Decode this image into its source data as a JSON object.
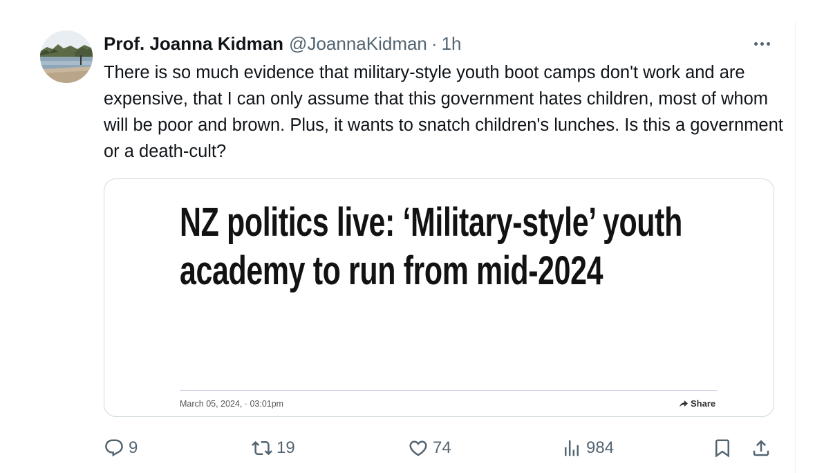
{
  "author": {
    "display_name": "Prof. Joanna Kidman",
    "handle": "@JoannaKidman",
    "separator": "·",
    "time": "1h"
  },
  "tweet": {
    "text": "There is so much evidence that military-style youth boot camps don't work and are expensive, that I can only assume that this government hates children, most of whom will be poor and brown. Plus, it wants to snatch children's lunches. Is this a government or a death-cult?"
  },
  "card": {
    "headline": "NZ politics live: ‘Military-style’ youth academy to run from mid-2024",
    "date": "March 05, 2024, · 03:01pm",
    "share_label": "Share"
  },
  "actions": {
    "replies": "9",
    "retweets": "19",
    "likes": "74",
    "views": "984"
  },
  "icons": {
    "more": "more-horizontal-icon",
    "reply": "reply-icon",
    "retweet": "retweet-icon",
    "like": "heart-icon",
    "views": "analytics-icon",
    "bookmark": "bookmark-icon",
    "share": "share-icon",
    "card_share": "share-arrow-icon"
  },
  "colors": {
    "text_primary": "#0f1419",
    "text_secondary": "#536471",
    "border": "#cfd9de"
  }
}
